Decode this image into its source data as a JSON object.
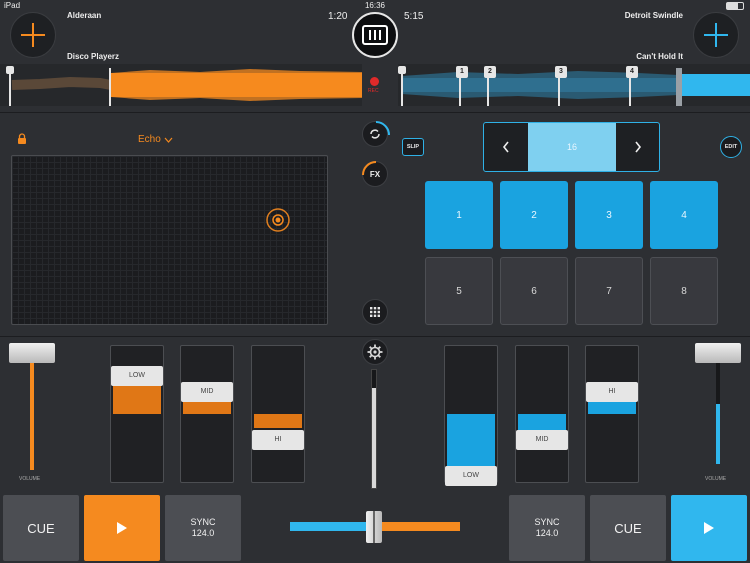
{
  "status_bar": {
    "device": "iPad",
    "clock": "16:36"
  },
  "deck_a": {
    "track_artist": "Alderaan",
    "track_title": "Disco Playerz",
    "time": "1:20",
    "accent": "#f58a1f",
    "cue": "CUE",
    "sync_label": "SYNC",
    "bpm": "124.0",
    "volume_label": "VOLUME",
    "eq": [
      "LOW",
      "MID",
      "HI"
    ]
  },
  "deck_b": {
    "track_artist": "Detroit Swindle",
    "track_title": "Can't Hold It",
    "time": "5:15",
    "accent": "#30b7ee",
    "cue": "CUE",
    "sync_label": "SYNC",
    "bpm": "124.0",
    "volume_label": "VOLUME",
    "eq": [
      "LOW",
      "MID",
      "HI"
    ],
    "cue_markers": [
      "1",
      "2",
      "3",
      "4"
    ]
  },
  "center": {
    "rec_label": "REC",
    "fx_label": "FX"
  },
  "fx_panel": {
    "effect": "Echo"
  },
  "pads_panel": {
    "slip": "SLIP",
    "edit": "EDIT",
    "loop_size": "16",
    "pads": [
      "1",
      "2",
      "3",
      "4",
      "5",
      "6",
      "7",
      "8"
    ]
  },
  "icons": [
    "add-icon",
    "turntable-logo-icon",
    "lock-icon",
    "chevron-down-icon",
    "chevron-left-icon",
    "chevron-right-icon",
    "loop-icon",
    "grid-icon",
    "gear-icon",
    "play-icon"
  ]
}
